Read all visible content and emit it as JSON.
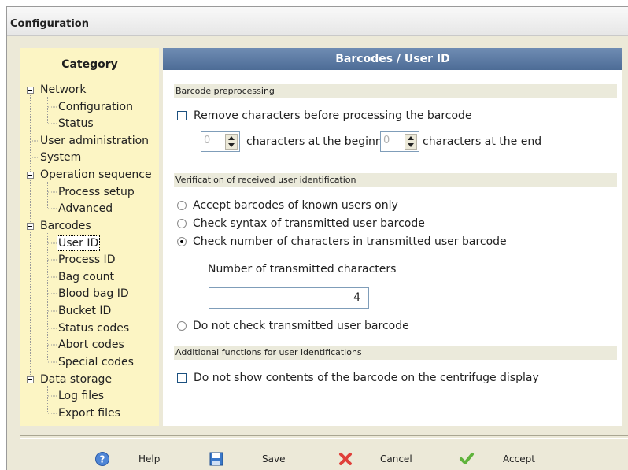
{
  "window": {
    "title": "Configuration"
  },
  "sidebar": {
    "header": "Category",
    "items": [
      {
        "label": "Network",
        "level": 0,
        "expanded": true
      },
      {
        "label": "Configuration",
        "level": 1
      },
      {
        "label": "Status",
        "level": 1
      },
      {
        "label": "User administration",
        "level": 0
      },
      {
        "label": "System",
        "level": 0
      },
      {
        "label": "Operation sequence",
        "level": 0,
        "expanded": true
      },
      {
        "label": "Process setup",
        "level": 1
      },
      {
        "label": "Advanced",
        "level": 1
      },
      {
        "label": "Barcodes",
        "level": 0,
        "expanded": true
      },
      {
        "label": "User ID",
        "level": 1,
        "selected": true
      },
      {
        "label": "Process ID",
        "level": 1
      },
      {
        "label": "Bag count",
        "level": 1
      },
      {
        "label": "Blood bag ID",
        "level": 1
      },
      {
        "label": "Bucket ID",
        "level": 1
      },
      {
        "label": "Status codes",
        "level": 1
      },
      {
        "label": "Abort codes",
        "level": 1
      },
      {
        "label": "Special codes",
        "level": 1
      },
      {
        "label": "Data storage",
        "level": 0,
        "expanded": true
      },
      {
        "label": "Log files",
        "level": 1
      },
      {
        "label": "Export files",
        "level": 1
      }
    ]
  },
  "main": {
    "title": "Barcodes / User ID",
    "barcode_preprocessing": {
      "section_label": "Barcode preprocessing",
      "remove_chars_label": "Remove characters before processing the barcode",
      "remove_chars_checked": false,
      "begin_value": "0",
      "begin_label": "characters at the beginn",
      "end_value": "0",
      "end_label": "characters at the end"
    },
    "verification": {
      "section_label": "Verification of received user identification",
      "options": [
        {
          "label": "Accept barcodes of known users only",
          "checked": false
        },
        {
          "label": "Check syntax of transmitted user barcode",
          "checked": false
        },
        {
          "label": "Check number of characters in transmitted user barcode",
          "checked": true
        }
      ],
      "num_chars_label": "Number of transmitted characters",
      "num_chars_value": "4",
      "no_check_label": "Do not check transmitted user barcode"
    },
    "additional": {
      "section_label": "Additional functions for user identifications",
      "hide_contents_label": "Do not show contents of the barcode on the centrifuge display",
      "hide_contents_checked": false
    }
  },
  "footer": {
    "help_label": "Help",
    "save_label": "Save",
    "cancel_label": "Cancel",
    "accept_label": "Accept",
    "icons": {
      "help": "help-icon",
      "save": "floppy-disk-icon",
      "cancel": "red-x-icon",
      "accept": "green-checkmark-icon"
    }
  },
  "colors": {
    "sidebar_bg": "#fcf5c4",
    "header_bg": "#5777a1",
    "section_bg": "#ebeadb",
    "window_bg": "#ece9d8"
  }
}
